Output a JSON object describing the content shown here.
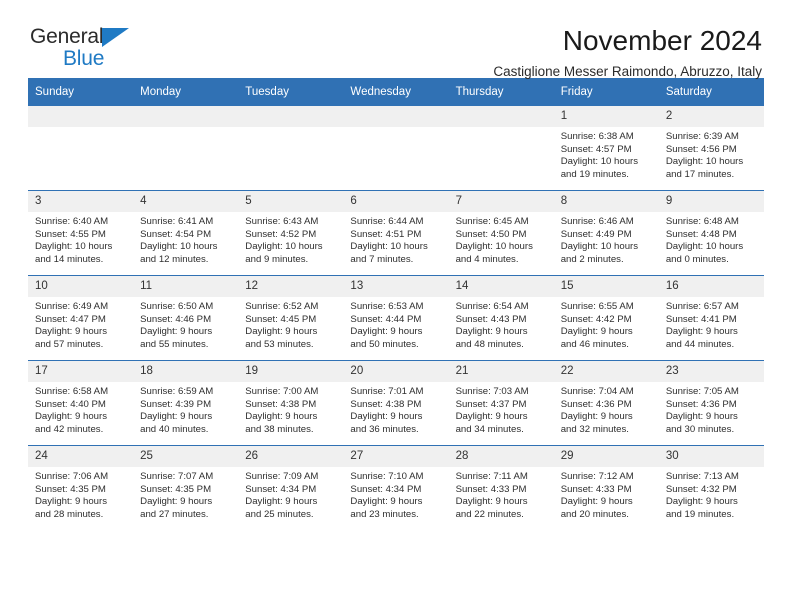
{
  "brand": {
    "name_part1": "General",
    "name_part2": "Blue",
    "triangle_icon": "triangle-icon",
    "accent_color": "#1f7ac4"
  },
  "header": {
    "title": "November 2024",
    "subtitle": "Castiglione Messer Raimondo, Abruzzo, Italy"
  },
  "colors": {
    "header_blue": "#3071b4",
    "daynum_gray": "#f0f0f0"
  },
  "calendar": {
    "weekday_headers": [
      "Sunday",
      "Monday",
      "Tuesday",
      "Wednesday",
      "Thursday",
      "Friday",
      "Saturday"
    ],
    "weeks": [
      [
        {
          "day": "",
          "empty": true,
          "sunrise": "",
          "sunset": "",
          "daylight1": "",
          "daylight2": ""
        },
        {
          "day": "",
          "empty": true,
          "sunrise": "",
          "sunset": "",
          "daylight1": "",
          "daylight2": ""
        },
        {
          "day": "",
          "empty": true,
          "sunrise": "",
          "sunset": "",
          "daylight1": "",
          "daylight2": ""
        },
        {
          "day": "",
          "empty": true,
          "sunrise": "",
          "sunset": "",
          "daylight1": "",
          "daylight2": ""
        },
        {
          "day": "",
          "empty": true,
          "sunrise": "",
          "sunset": "",
          "daylight1": "",
          "daylight2": ""
        },
        {
          "day": "1",
          "sunrise": "Sunrise: 6:38 AM",
          "sunset": "Sunset: 4:57 PM",
          "daylight1": "Daylight: 10 hours",
          "daylight2": "and 19 minutes."
        },
        {
          "day": "2",
          "sunrise": "Sunrise: 6:39 AM",
          "sunset": "Sunset: 4:56 PM",
          "daylight1": "Daylight: 10 hours",
          "daylight2": "and 17 minutes."
        }
      ],
      [
        {
          "day": "3",
          "sunrise": "Sunrise: 6:40 AM",
          "sunset": "Sunset: 4:55 PM",
          "daylight1": "Daylight: 10 hours",
          "daylight2": "and 14 minutes."
        },
        {
          "day": "4",
          "sunrise": "Sunrise: 6:41 AM",
          "sunset": "Sunset: 4:54 PM",
          "daylight1": "Daylight: 10 hours",
          "daylight2": "and 12 minutes."
        },
        {
          "day": "5",
          "sunrise": "Sunrise: 6:43 AM",
          "sunset": "Sunset: 4:52 PM",
          "daylight1": "Daylight: 10 hours",
          "daylight2": "and 9 minutes."
        },
        {
          "day": "6",
          "sunrise": "Sunrise: 6:44 AM",
          "sunset": "Sunset: 4:51 PM",
          "daylight1": "Daylight: 10 hours",
          "daylight2": "and 7 minutes."
        },
        {
          "day": "7",
          "sunrise": "Sunrise: 6:45 AM",
          "sunset": "Sunset: 4:50 PM",
          "daylight1": "Daylight: 10 hours",
          "daylight2": "and 4 minutes."
        },
        {
          "day": "8",
          "sunrise": "Sunrise: 6:46 AM",
          "sunset": "Sunset: 4:49 PM",
          "daylight1": "Daylight: 10 hours",
          "daylight2": "and 2 minutes."
        },
        {
          "day": "9",
          "sunrise": "Sunrise: 6:48 AM",
          "sunset": "Sunset: 4:48 PM",
          "daylight1": "Daylight: 10 hours",
          "daylight2": "and 0 minutes."
        }
      ],
      [
        {
          "day": "10",
          "sunrise": "Sunrise: 6:49 AM",
          "sunset": "Sunset: 4:47 PM",
          "daylight1": "Daylight: 9 hours",
          "daylight2": "and 57 minutes."
        },
        {
          "day": "11",
          "sunrise": "Sunrise: 6:50 AM",
          "sunset": "Sunset: 4:46 PM",
          "daylight1": "Daylight: 9 hours",
          "daylight2": "and 55 minutes."
        },
        {
          "day": "12",
          "sunrise": "Sunrise: 6:52 AM",
          "sunset": "Sunset: 4:45 PM",
          "daylight1": "Daylight: 9 hours",
          "daylight2": "and 53 minutes."
        },
        {
          "day": "13",
          "sunrise": "Sunrise: 6:53 AM",
          "sunset": "Sunset: 4:44 PM",
          "daylight1": "Daylight: 9 hours",
          "daylight2": "and 50 minutes."
        },
        {
          "day": "14",
          "sunrise": "Sunrise: 6:54 AM",
          "sunset": "Sunset: 4:43 PM",
          "daylight1": "Daylight: 9 hours",
          "daylight2": "and 48 minutes."
        },
        {
          "day": "15",
          "sunrise": "Sunrise: 6:55 AM",
          "sunset": "Sunset: 4:42 PM",
          "daylight1": "Daylight: 9 hours",
          "daylight2": "and 46 minutes."
        },
        {
          "day": "16",
          "sunrise": "Sunrise: 6:57 AM",
          "sunset": "Sunset: 4:41 PM",
          "daylight1": "Daylight: 9 hours",
          "daylight2": "and 44 minutes."
        }
      ],
      [
        {
          "day": "17",
          "sunrise": "Sunrise: 6:58 AM",
          "sunset": "Sunset: 4:40 PM",
          "daylight1": "Daylight: 9 hours",
          "daylight2": "and 42 minutes."
        },
        {
          "day": "18",
          "sunrise": "Sunrise: 6:59 AM",
          "sunset": "Sunset: 4:39 PM",
          "daylight1": "Daylight: 9 hours",
          "daylight2": "and 40 minutes."
        },
        {
          "day": "19",
          "sunrise": "Sunrise: 7:00 AM",
          "sunset": "Sunset: 4:38 PM",
          "daylight1": "Daylight: 9 hours",
          "daylight2": "and 38 minutes."
        },
        {
          "day": "20",
          "sunrise": "Sunrise: 7:01 AM",
          "sunset": "Sunset: 4:38 PM",
          "daylight1": "Daylight: 9 hours",
          "daylight2": "and 36 minutes."
        },
        {
          "day": "21",
          "sunrise": "Sunrise: 7:03 AM",
          "sunset": "Sunset: 4:37 PM",
          "daylight1": "Daylight: 9 hours",
          "daylight2": "and 34 minutes."
        },
        {
          "day": "22",
          "sunrise": "Sunrise: 7:04 AM",
          "sunset": "Sunset: 4:36 PM",
          "daylight1": "Daylight: 9 hours",
          "daylight2": "and 32 minutes."
        },
        {
          "day": "23",
          "sunrise": "Sunrise: 7:05 AM",
          "sunset": "Sunset: 4:36 PM",
          "daylight1": "Daylight: 9 hours",
          "daylight2": "and 30 minutes."
        }
      ],
      [
        {
          "day": "24",
          "sunrise": "Sunrise: 7:06 AM",
          "sunset": "Sunset: 4:35 PM",
          "daylight1": "Daylight: 9 hours",
          "daylight2": "and 28 minutes."
        },
        {
          "day": "25",
          "sunrise": "Sunrise: 7:07 AM",
          "sunset": "Sunset: 4:35 PM",
          "daylight1": "Daylight: 9 hours",
          "daylight2": "and 27 minutes."
        },
        {
          "day": "26",
          "sunrise": "Sunrise: 7:09 AM",
          "sunset": "Sunset: 4:34 PM",
          "daylight1": "Daylight: 9 hours",
          "daylight2": "and 25 minutes."
        },
        {
          "day": "27",
          "sunrise": "Sunrise: 7:10 AM",
          "sunset": "Sunset: 4:34 PM",
          "daylight1": "Daylight: 9 hours",
          "daylight2": "and 23 minutes."
        },
        {
          "day": "28",
          "sunrise": "Sunrise: 7:11 AM",
          "sunset": "Sunset: 4:33 PM",
          "daylight1": "Daylight: 9 hours",
          "daylight2": "and 22 minutes."
        },
        {
          "day": "29",
          "sunrise": "Sunrise: 7:12 AM",
          "sunset": "Sunset: 4:33 PM",
          "daylight1": "Daylight: 9 hours",
          "daylight2": "and 20 minutes."
        },
        {
          "day": "30",
          "sunrise": "Sunrise: 7:13 AM",
          "sunset": "Sunset: 4:32 PM",
          "daylight1": "Daylight: 9 hours",
          "daylight2": "and 19 minutes."
        }
      ]
    ]
  }
}
